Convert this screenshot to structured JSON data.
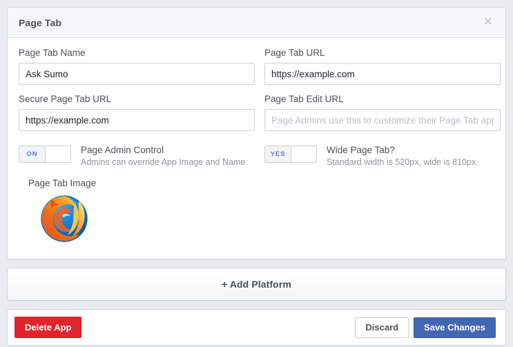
{
  "dialog": {
    "title": "Page Tab",
    "close_icon": "close-icon",
    "close_glyph": "✕"
  },
  "form": {
    "fields": [
      {
        "label": "Page Tab Name",
        "value": "Ask Sumo",
        "placeholder": "",
        "name": "page-tab-name"
      },
      {
        "label": "Page Tab URL",
        "value": "https://example.com",
        "placeholder": "",
        "name": "page-tab-url"
      },
      {
        "label": "Secure Page Tab URL",
        "value": "https://example.com",
        "placeholder": "",
        "name": "secure-page-tab-url"
      },
      {
        "label": "Page Tab Edit URL",
        "value": "",
        "placeholder": "Page Admins use this to customize their Page Tab app",
        "name": "page-tab-edit-url"
      }
    ]
  },
  "toggles": [
    {
      "state_label": "ON",
      "title": "Page Admin Control",
      "description": "Admins can override App Image and Name",
      "name": "page-admin-control-toggle"
    },
    {
      "state_label": "YES",
      "title": "Wide Page Tab?",
      "description": "Standard width is 520px, wide is 810px.",
      "name": "wide-page-tab-toggle"
    }
  ],
  "image_section": {
    "label": "Page Tab Image",
    "icon_name": "firefox-logo-image"
  },
  "add_platform": {
    "label": "+ Add Platform"
  },
  "footer": {
    "delete_label": "Delete App",
    "discard_label": "Discard",
    "save_label": "Save Changes"
  },
  "colors": {
    "background": "#e9ebee",
    "card": "#ffffff",
    "header_bg": "#f6f7f9",
    "label_text": "#4b4f56",
    "muted_text": "#90949c",
    "toggle_accent": "#4f7fdb",
    "delete_red": "#e1242c",
    "save_blue": "#4267b2",
    "border": "#ccd0d5"
  }
}
